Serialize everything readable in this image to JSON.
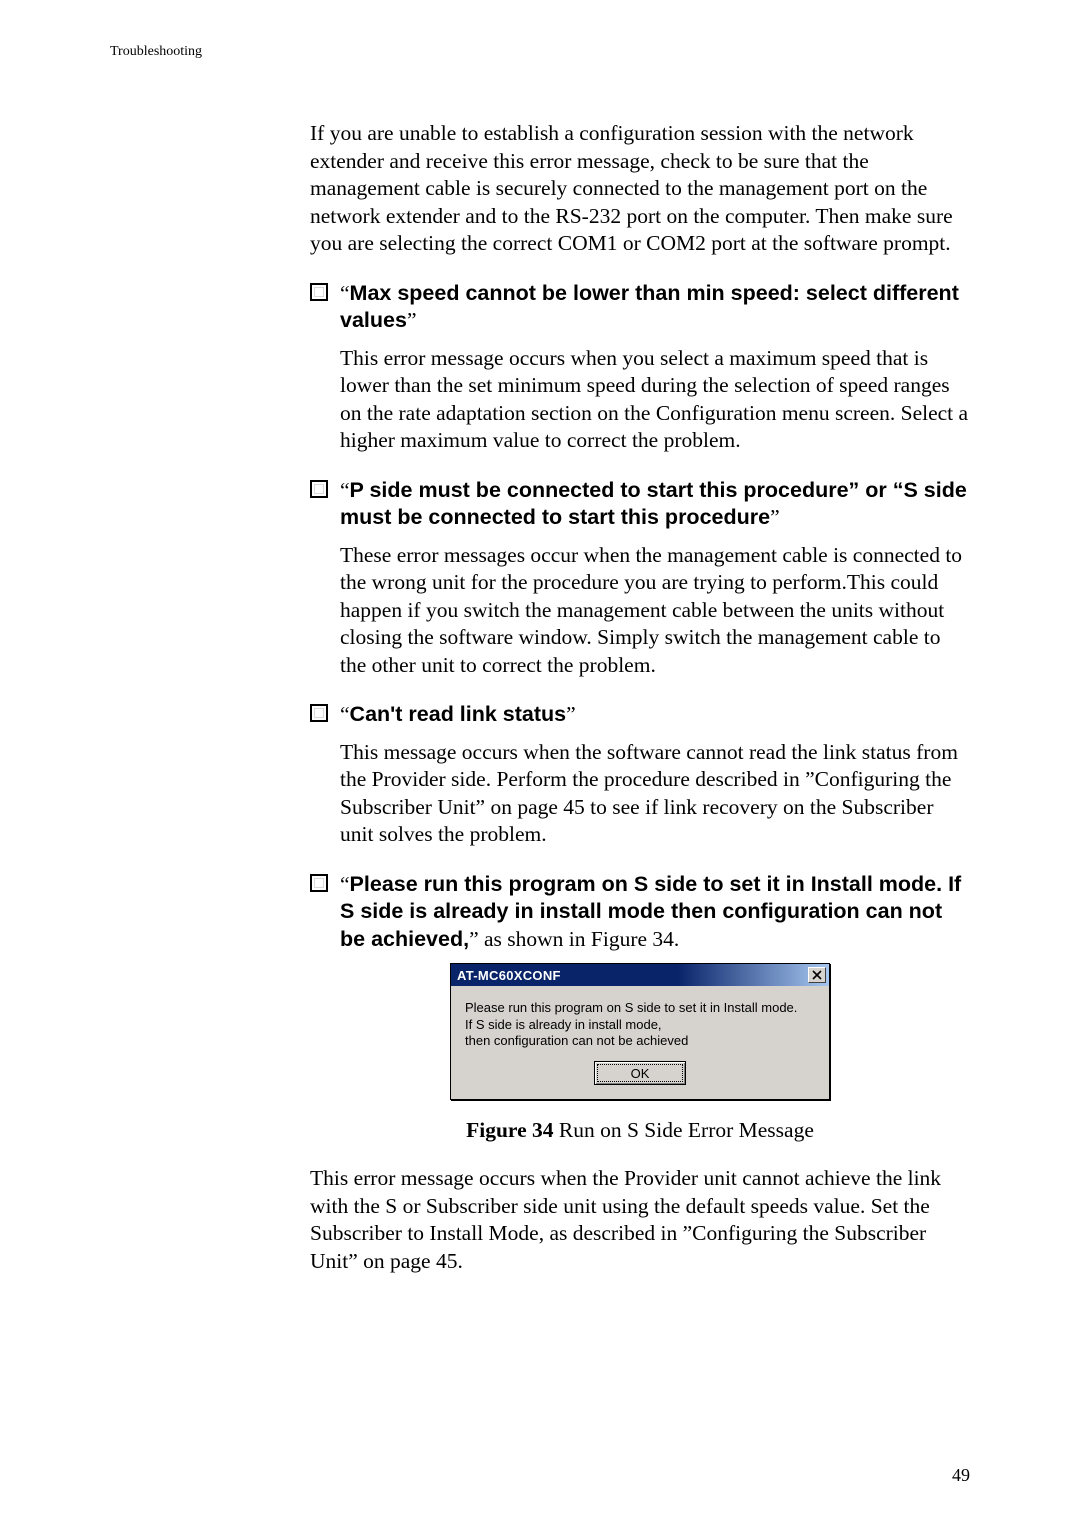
{
  "running_head": "Troubleshooting",
  "p_intro": "If you are unable to establish a configuration session with the network extender and receive this error message, check to be sure that the management cable is securely connected to the management port on the network extender and to the RS-232 port on the computer. Then make sure you are selecting the correct COM1 or COM2 port at the software prompt.",
  "b1": {
    "q1": "“",
    "bold": "Max speed cannot be lower than min speed: select different values",
    "q2": "”"
  },
  "p1": "This error message occurs when you select a maximum speed that is lower than the set minimum speed during the selection of speed ranges on the rate adaptation section on the Configuration menu screen. Select a higher maximum value to correct the problem.",
  "b2": {
    "q1": "“",
    "bold": "P side must be connected to start this procedure” or “S side must be connected to start this procedure",
    "q2": "”"
  },
  "p2": "These error messages occur when the management cable is connected to the wrong unit for the procedure you are trying to perform.This could happen if you switch the management cable between the units without closing the software window. Simply switch the management cable to the other unit to correct the problem.",
  "b3": {
    "q1": "“",
    "bold": "Can't read link status",
    "q2": "”"
  },
  "p3": "This message occurs when the software cannot read the link status from the Provider side. Perform the procedure described in ”Configuring the Subscriber Unit” on page 45 to see if link recovery on the Subscriber unit solves the problem.",
  "b4": {
    "q1": "“",
    "bold": "Please run this program on S side to set it in Install mode. If S side is already in install mode then configuration can not be achieved,",
    "q2": "”",
    "tail": " as shown in Figure 34."
  },
  "dialog": {
    "title": "AT-MC60XCONF",
    "line1": "Please run this program on S side to set it in Install mode.",
    "line2": "If S side is already in install mode,",
    "line3": "then configuration can not be achieved",
    "ok": "OK"
  },
  "fig": {
    "lead": "Figure 34",
    "rest": "  Run on S Side Error Message"
  },
  "p_out": "This error message occurs when the Provider unit cannot achieve the link with the S or Subscriber side unit using the default speeds value. Set the Subscriber to Install Mode, as described in ”Configuring the Subscriber Unit” on page 45.",
  "page_num": "49"
}
